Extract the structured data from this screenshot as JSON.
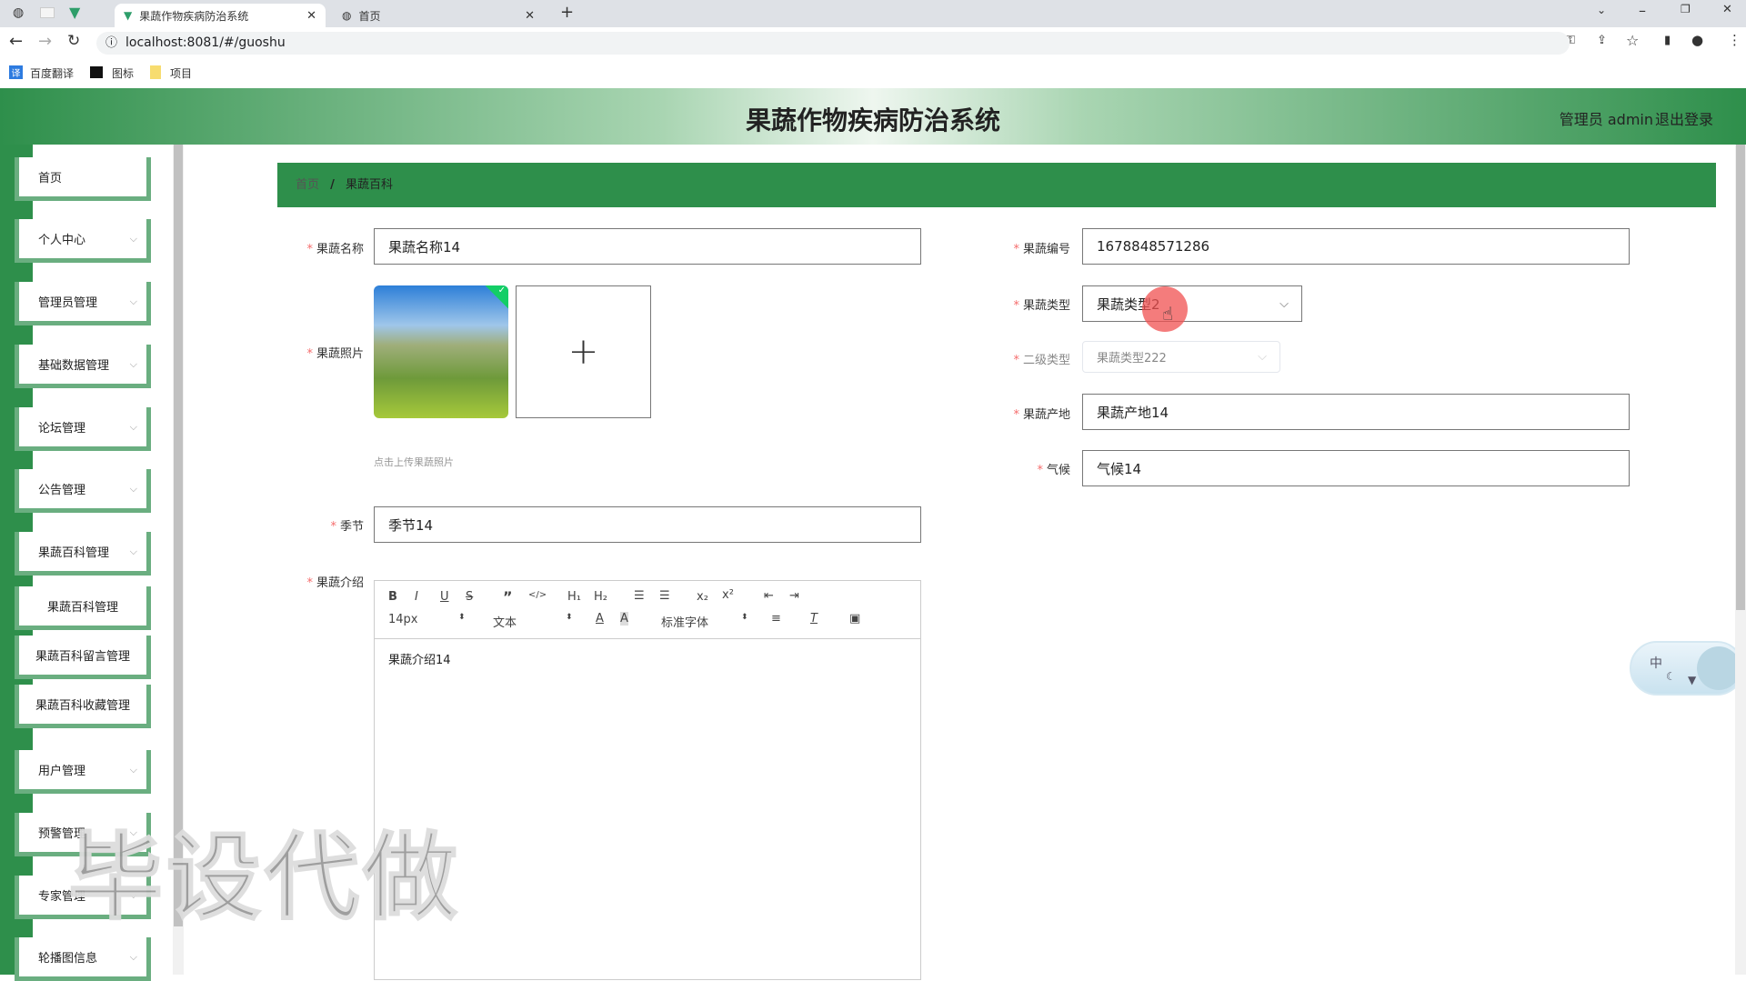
{
  "browser": {
    "tabs": [
      {
        "label": "果蔬作物疾病防治系统",
        "active": true
      },
      {
        "label": "首页",
        "active": false
      }
    ],
    "url": "localhost:8081/#/guoshu",
    "bookmarks": [
      "百度翻译",
      "图标",
      "项目"
    ]
  },
  "header": {
    "title": "果蔬作物疾病防治系统",
    "user": "管理员 admin",
    "logout": "退出登录"
  },
  "sidebar": {
    "items": [
      {
        "label": "首页",
        "chevron": false
      },
      {
        "label": "个人中心",
        "chevron": true
      },
      {
        "label": "管理员管理",
        "chevron": true
      },
      {
        "label": "基础数据管理",
        "chevron": true
      },
      {
        "label": "论坛管理",
        "chevron": true
      },
      {
        "label": "公告管理",
        "chevron": true
      },
      {
        "label": "果蔬百科管理",
        "chevron": true,
        "children": [
          "果蔬百科管理",
          "果蔬百科留言管理",
          "果蔬百科收藏管理"
        ]
      },
      {
        "label": "用户管理",
        "chevron": true
      },
      {
        "label": "预警管理",
        "chevron": true
      },
      {
        "label": "专家管理",
        "chevron": true
      },
      {
        "label": "轮播图信息",
        "chevron": true
      }
    ]
  },
  "breadcrumb": {
    "home": "首页",
    "sep": "/",
    "current": "果蔬百科"
  },
  "form": {
    "name": {
      "label": "果蔬名称",
      "value": "果蔬名称14"
    },
    "photo": {
      "label": "果蔬照片",
      "hint": "点击上传果蔬照片",
      "add": "+"
    },
    "season": {
      "label": "季节",
      "value": "季节14"
    },
    "intro": {
      "label": "果蔬介绍",
      "value": "果蔬介绍14"
    },
    "code": {
      "label": "果蔬编号",
      "value": "1678848571286"
    },
    "type": {
      "label": "果蔬类型",
      "value": "果蔬类型2"
    },
    "subtype": {
      "label": "二级类型",
      "value": "果蔬类型222"
    },
    "origin": {
      "label": "果蔬产地",
      "value": "果蔬产地14"
    },
    "climate": {
      "label": "气候",
      "value": "气候14"
    }
  },
  "editor": {
    "size": "14px",
    "block": "文本",
    "font": "标准字体"
  },
  "watermark": "毕设代做",
  "widget": {
    "label": "中"
  },
  "colors": {
    "primary": "#2e8f4b",
    "sidebar_border": "#6aae80",
    "required": "#f56c6c"
  }
}
